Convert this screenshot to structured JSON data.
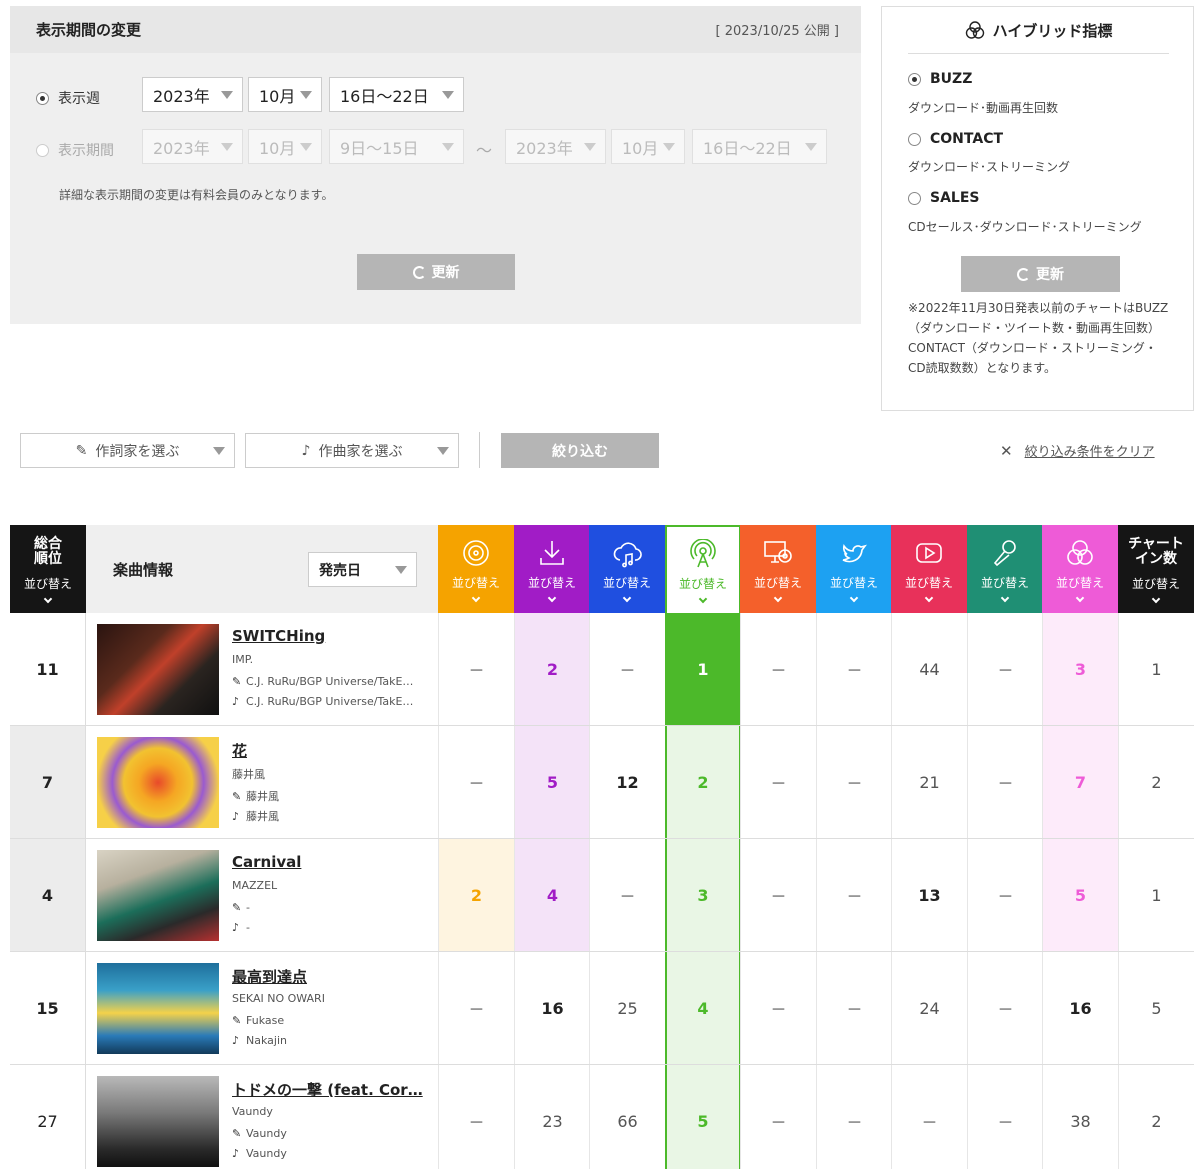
{
  "period": {
    "title": "表示期間の変更",
    "published": "[ 2023/10/25 公開 ]",
    "week_label": "表示週",
    "week": {
      "year": "2023年",
      "month": "10月",
      "range": "16日～22日"
    },
    "range_label": "表示期間",
    "from": {
      "year": "2023年",
      "month": "10月",
      "range": "9日～15日"
    },
    "tilde": "～",
    "to": {
      "year": "2023年",
      "month": "10月",
      "range": "16日～22日"
    },
    "note": "詳細な表示期間の変更は有料会員のみとなります。",
    "update_label": "更新"
  },
  "hybrid": {
    "title": "ハイブリッド指標",
    "options": [
      {
        "name": "BUZZ",
        "desc": "ダウンロード･動画再生回数",
        "selected": true
      },
      {
        "name": "CONTACT",
        "desc": "ダウンロード･ストリーミング",
        "selected": false
      },
      {
        "name": "SALES",
        "desc": "CDセールス･ダウンロード･ストリーミング",
        "selected": false
      }
    ],
    "update_label": "更新",
    "note": "※2022年11月30日発表以前のチャートはBUZZ（ダウンロード・ツイート数・動画再生回数）CONTACT（ダウンロード・ストリーミング・CD読取数数）となります。"
  },
  "filters": {
    "lyricist_label": "作詞家を選ぶ",
    "composer_label": "作曲家を選ぶ",
    "narrow_label": "絞り込む",
    "clear_label": "絞り込み条件をクリア"
  },
  "table": {
    "rank_head": "総合順位",
    "rank_head_l1": "総合",
    "rank_head_l2": "順位",
    "sort_label": "並び替え",
    "song_head": "楽曲情報",
    "release_select": "発売日",
    "chart_in_l1": "チャート",
    "chart_in_l2": "イン数",
    "columns": [
      {
        "icon": "cd-icon",
        "color": "#f5a300"
      },
      {
        "icon": "download-icon",
        "color": "#a11cc6"
      },
      {
        "icon": "cloud-music-icon",
        "color": "#1f4fe0"
      },
      {
        "icon": "buzz-antenna-icon",
        "color": "#4cb92a"
      },
      {
        "icon": "pc-disc-icon",
        "color": "#f4602b"
      },
      {
        "icon": "twitter-icon",
        "color": "#1da1f2"
      },
      {
        "icon": "youtube-icon",
        "color": "#e8315a"
      },
      {
        "icon": "karaoke-mic-icon",
        "color": "#1f8f74"
      },
      {
        "icon": "hybrid-icon",
        "color": "#ee5bd7"
      }
    ],
    "rows": [
      {
        "rank": "11",
        "title": "SWITCHing",
        "artist": "IMP.",
        "lyricist": "C.J. RuRu/BGP Universe/TakE…",
        "composer": "C.J. RuRu/BGP Universe/TakE…",
        "values": [
          "－",
          "2",
          "－",
          "1",
          "－",
          "－",
          "44",
          "－",
          "3"
        ],
        "chart_in": "1"
      },
      {
        "rank": "7",
        "title": "花",
        "artist": "藤井風",
        "lyricist": "藤井風",
        "composer": "藤井風",
        "values": [
          "－",
          "5",
          "12",
          "2",
          "－",
          "－",
          "21",
          "－",
          "7"
        ],
        "chart_in": "2"
      },
      {
        "rank": "4",
        "title": "Carnival",
        "artist": "MAZZEL",
        "lyricist": "-",
        "composer": "-",
        "values": [
          "2",
          "4",
          "－",
          "3",
          "－",
          "－",
          "13",
          "－",
          "5"
        ],
        "chart_in": "1"
      },
      {
        "rank": "15",
        "title": "最高到達点",
        "artist": "SEKAI NO OWARI",
        "lyricist": "Fukase",
        "composer": "Nakajin",
        "values": [
          "－",
          "16",
          "25",
          "4",
          "－",
          "－",
          "24",
          "－",
          "16"
        ],
        "chart_in": "5"
      },
      {
        "rank": "27",
        "title": "トドメの一撃 (feat. Cor…",
        "artist": "Vaundy",
        "lyricist": "Vaundy",
        "composer": "Vaundy",
        "values": [
          "－",
          "23",
          "66",
          "5",
          "－",
          "－",
          "－",
          "－",
          "38"
        ],
        "chart_in": "2"
      }
    ]
  },
  "colors": {
    "buzz_green": "#4cb92a",
    "header_black": "#151515",
    "button_grey": "#b5b5b5"
  }
}
